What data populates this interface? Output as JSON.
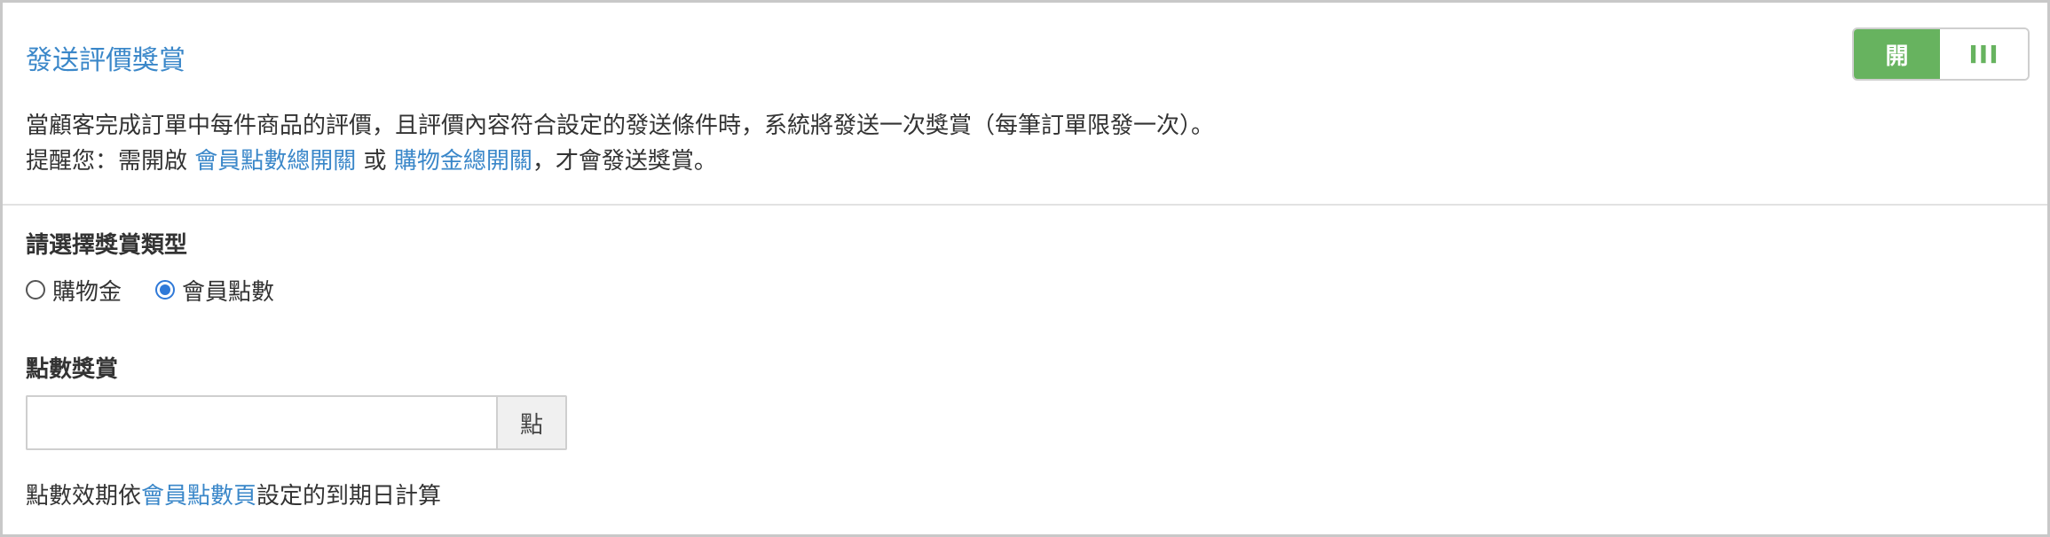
{
  "header": {
    "title": "發送評價獎賞",
    "toggle": {
      "on_label": "開",
      "off_label": "III"
    }
  },
  "description": {
    "line1": "當顧客完成訂單中每件商品的評價，且評價內容符合設定的發送條件時，系統將發送一次獎賞（每筆訂單限發一次）。",
    "line2_prefix": "提醒您：需開啟 ",
    "line2_link1": "會員點數總開關",
    "line2_mid": " 或 ",
    "line2_link2": "購物金總開關",
    "line2_suffix": "，才會發送獎賞。"
  },
  "reward_type": {
    "label": "請選擇獎賞類型",
    "options": [
      {
        "label": "購物金",
        "checked": false
      },
      {
        "label": "會員點數",
        "checked": true
      }
    ]
  },
  "points_reward": {
    "label": "點數獎賞",
    "input_value": "",
    "input_placeholder": "",
    "unit": "點"
  },
  "note": {
    "prefix": "點數效期依",
    "link": "會員點數頁",
    "suffix": "設定的到期日計算"
  },
  "colors": {
    "link": "#3a87c9",
    "toggle_on": "#67b35f",
    "radio_checked": "#2f79d8"
  }
}
